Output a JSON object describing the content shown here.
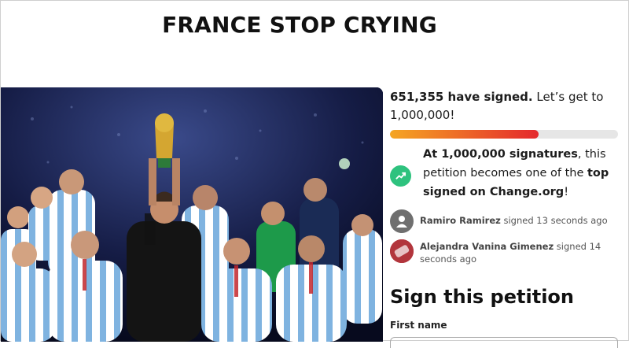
{
  "page": {
    "title": "FRANCE STOP CRYING"
  },
  "petition": {
    "signed_count": "651,355 have signed.",
    "goal_text": " Let’s get to 1,000,000!",
    "progress_fraction": 0.651355,
    "progress_color_start": "#f5a623",
    "progress_color_end": "#e4282c",
    "milestone": {
      "icon": "trending-up-icon",
      "icon_color": "#2ec27e",
      "part1_bold": "At 1,000,000 signatures",
      "part2": ", this petition becomes one of the ",
      "part3_bold": "top signed on Change.org",
      "part4": "!"
    }
  },
  "activity": [
    {
      "name": "Ramiro Ramirez",
      "action": " signed 13 seconds ago",
      "avatar": "default-user-icon"
    },
    {
      "name": "Alejandra Vanina Gimenez",
      "action": " signed 14 seconds ago",
      "avatar": "user-photo"
    }
  ],
  "sign_form": {
    "heading": "Sign this petition",
    "first_name_label": "First name"
  }
}
